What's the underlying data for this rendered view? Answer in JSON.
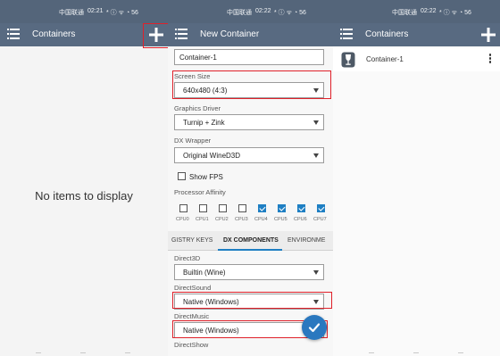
{
  "panel1": {
    "status": {
      "carrier": "中国联通",
      "time": "02:21",
      "icons": "* ⓘ ᯤ ◔ 56"
    },
    "appbar": {
      "title": "Containers",
      "menu_icon": "menu-icon",
      "add_icon": "plus-icon"
    },
    "empty_text": "No items to display"
  },
  "panel2": {
    "status": {
      "carrier": "中国联通",
      "time": "02:22",
      "icons": "* ⓘ ᯤ ◔ 56"
    },
    "appbar": {
      "title": "New Container",
      "menu_icon": "menu-icon"
    },
    "form": {
      "name_value": "Container-1",
      "screen_size": {
        "label": "Screen Size",
        "value": "640x480 (4:3)"
      },
      "graphics_driver": {
        "label": "Graphics Driver",
        "value": "Turnip + Zink"
      },
      "dx_wrapper": {
        "label": "DX Wrapper",
        "value": "Original WineD3D"
      },
      "show_fps": {
        "label": "Show FPS",
        "checked": false
      },
      "processor_affinity": {
        "label": "Processor Affinity",
        "cpus": [
          {
            "label": "CPU0",
            "checked": false
          },
          {
            "label": "CPU1",
            "checked": false
          },
          {
            "label": "CPU2",
            "checked": false
          },
          {
            "label": "CPU3",
            "checked": false
          },
          {
            "label": "CPU4",
            "checked": true
          },
          {
            "label": "CPU5",
            "checked": true
          },
          {
            "label": "CPU6",
            "checked": true
          },
          {
            "label": "CPU7",
            "checked": true
          }
        ]
      },
      "tabs": [
        {
          "label": "GISTRY KEYS",
          "active": false
        },
        {
          "label": "DX COMPONENTS",
          "active": true
        },
        {
          "label": "ENVIRONME",
          "active": false
        }
      ],
      "direct3d": {
        "label": "Direct3D",
        "value": "Builtin (Wine)"
      },
      "directsound": {
        "label": "DirectSound",
        "value": "Native (Windows)"
      },
      "directmusic": {
        "label": "DirectMusic",
        "value": "Native (Windows)"
      },
      "directshow": {
        "label": "DirectShow"
      }
    },
    "fab_icon": "check-icon"
  },
  "panel3": {
    "status": {
      "carrier": "中国联通",
      "time": "02:22",
      "icons": "* ⓘ ᯤ ◔ 56"
    },
    "appbar": {
      "title": "Containers",
      "menu_icon": "menu-icon",
      "add_icon": "plus-icon"
    },
    "items": [
      {
        "name": "Container-1",
        "icon": "wine-glass-icon"
      }
    ]
  },
  "colors": {
    "appbar": "#586a81",
    "statusbar": "#54657a",
    "accent": "#1e7fc3",
    "fab": "#2a78bf",
    "highlight": "#e0212a"
  }
}
